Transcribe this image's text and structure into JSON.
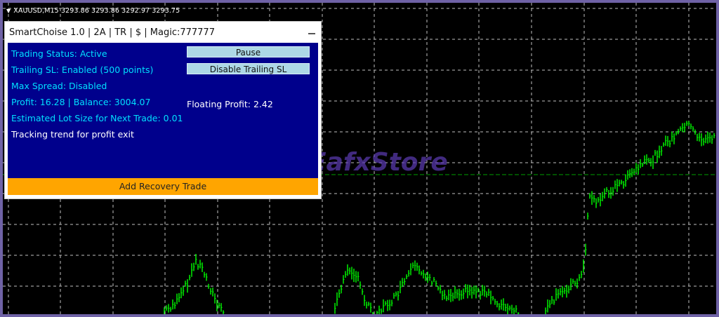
{
  "chart": {
    "symbol": "XAUUSD,M15",
    "ohlc": "3293.86 3293.86 3292.97 3293.75",
    "symbol_label": "XAUUSD,M15  3293.86 3293.86 3292.97 3293.75",
    "grid": true,
    "background": "#000000",
    "grid_color": "#c0c0c0",
    "bar_color": "#00ff00",
    "price_line_color": "#00a000"
  },
  "panel": {
    "title": "SmartChoise 1.0 | 2A | TR | $ | Magic:777777",
    "trading_status": "Trading Status: Active",
    "trailing_sl": "Trailing SL: Enabled  (500 points)",
    "max_spread": "Max Spread: Disabled",
    "profit_balance": "Profit: 16.28 | Balance: 3004.07",
    "lot_size": "Estimated Lot Size for Next Trade: 0.01",
    "trend_status": "Tracking trend for profit exit",
    "floating_profit": "Floating Profit: 2.42",
    "pause_label": "Pause",
    "disable_trailing_label": "Disable Trailing SL",
    "recovery_label": "Add Recovery Trade",
    "colors": {
      "body": "#00008c",
      "accent_text": "#00e0ff",
      "button": "#add8e6",
      "recovery": "#ffa500"
    }
  },
  "watermark": {
    "text": "EafxStore",
    "icon": "shopping-cart-icon"
  }
}
